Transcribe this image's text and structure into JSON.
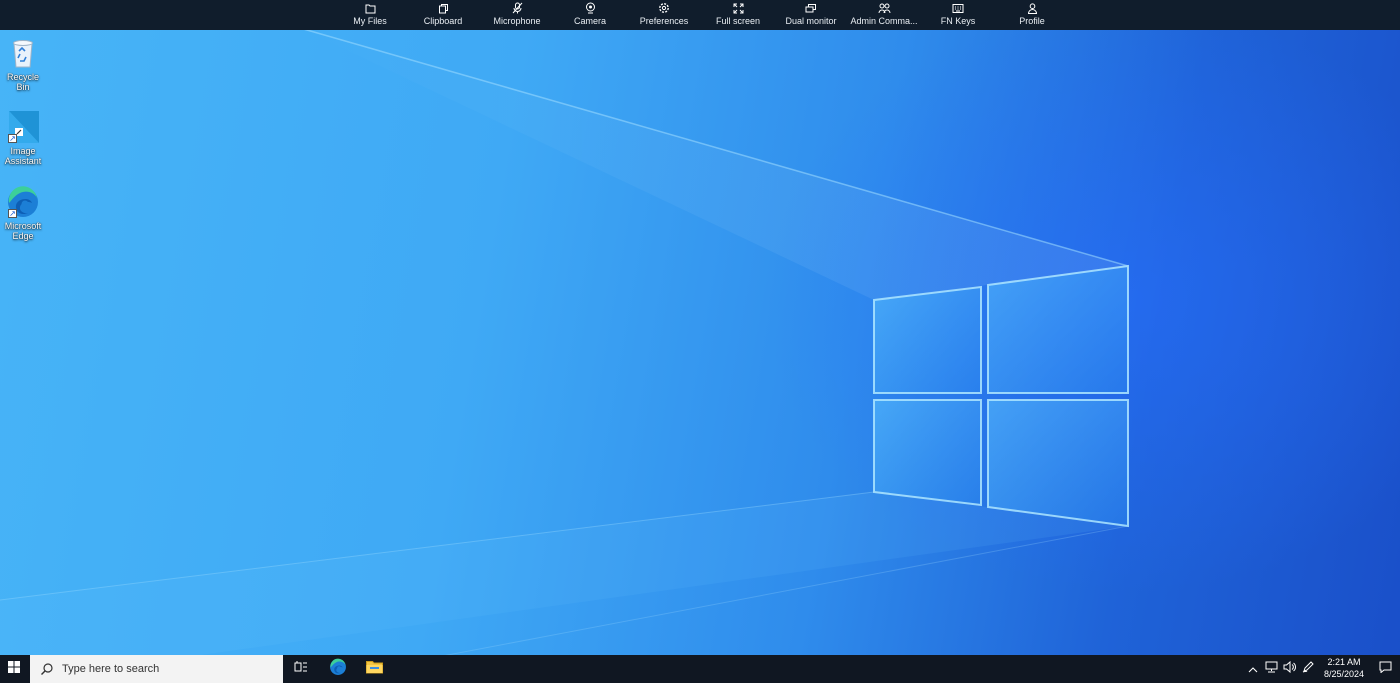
{
  "toolbar": {
    "items": [
      {
        "label": "My Files",
        "icon": "folder-icon"
      },
      {
        "label": "Clipboard",
        "icon": "clipboard-icon"
      },
      {
        "label": "Microphone",
        "icon": "microphone-muted-icon"
      },
      {
        "label": "Camera",
        "icon": "camera-icon"
      },
      {
        "label": "Preferences",
        "icon": "gear-icon"
      },
      {
        "label": "Full screen",
        "icon": "fullscreen-icon"
      },
      {
        "label": "Dual monitor",
        "icon": "dual-monitor-icon"
      },
      {
        "label": "Admin Comma...",
        "icon": "admin-users-icon"
      },
      {
        "label": "FN Keys",
        "icon": "keyboard-icon"
      },
      {
        "label": "Profile",
        "icon": "profile-icon"
      }
    ]
  },
  "desktop": {
    "icons": [
      {
        "label": "Recycle Bin",
        "icon": "recycle-bin-icon"
      },
      {
        "label": "Image Assistant",
        "icon": "image-assistant-icon"
      },
      {
        "label": "Microsoft Edge",
        "icon": "edge-icon"
      }
    ]
  },
  "taskbar": {
    "search_placeholder": "Type here to search",
    "pinned": [
      {
        "name": "task-view",
        "icon": "task-view-icon"
      },
      {
        "name": "microsoft-edge",
        "icon": "edge-icon"
      },
      {
        "name": "file-explorer",
        "icon": "file-explorer-icon"
      }
    ],
    "tray": [
      "chevron-up-icon",
      "network-icon",
      "volume-icon",
      "pen-icon"
    ],
    "time": "2:21 AM",
    "date": "8/25/2024"
  },
  "colors": {
    "toolbar_bg": "#101d2c",
    "taskbar_bg": "#101722",
    "wallpaper_light": "#47b4f7",
    "wallpaper_dark": "#1a4fc9"
  }
}
